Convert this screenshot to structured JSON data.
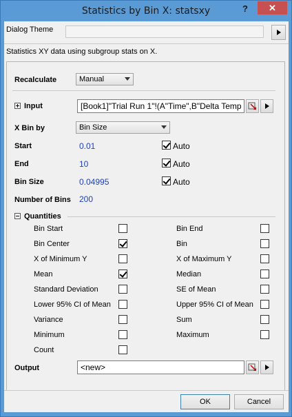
{
  "window": {
    "title": "Statistics by Bin X: statsxy",
    "help_label": "?",
    "close_label": "✕"
  },
  "theme": {
    "label": "Dialog Theme",
    "value": ""
  },
  "description": "Statistics XY data using subgroup stats on X.",
  "recalculate": {
    "label": "Recalculate",
    "value": "Manual"
  },
  "input": {
    "label": "Input",
    "value": "[Book1]\"Trial Run 1\"!(A\"Time\",B\"Delta Temp"
  },
  "xbin": {
    "label": "X Bin by",
    "value": "Bin Size"
  },
  "start": {
    "label": "Start",
    "value": "0.01",
    "auto_label": "Auto",
    "auto_checked": true
  },
  "end": {
    "label": "End",
    "value": "10",
    "auto_label": "Auto",
    "auto_checked": true
  },
  "binsize": {
    "label": "Bin Size",
    "value": "0.04995",
    "auto_label": "Auto",
    "auto_checked": true
  },
  "numbins": {
    "label": "Number of Bins",
    "value": "200"
  },
  "quantities": {
    "label": "Quantities",
    "items": [
      {
        "label": "Bin Start",
        "checked": false
      },
      {
        "label": "Bin End",
        "checked": false
      },
      {
        "label": "Bin Center",
        "checked": true
      },
      {
        "label": "Bin",
        "checked": false
      },
      {
        "label": "X of Minimum Y",
        "checked": false
      },
      {
        "label": "X of Maximum Y",
        "checked": false
      },
      {
        "label": "Mean",
        "checked": true
      },
      {
        "label": "Median",
        "checked": false
      },
      {
        "label": "Standard Deviation",
        "checked": false
      },
      {
        "label": "SE of Mean",
        "checked": false
      },
      {
        "label": "Lower 95% CI of Mean",
        "checked": false
      },
      {
        "label": "Upper 95% CI of Mean",
        "checked": false
      },
      {
        "label": "Variance",
        "checked": false
      },
      {
        "label": "Sum",
        "checked": false
      },
      {
        "label": "Minimum",
        "checked": false
      },
      {
        "label": "Maximum",
        "checked": false
      },
      {
        "label": "Count",
        "checked": false
      }
    ]
  },
  "output": {
    "label": "Output",
    "value": "<new>"
  },
  "buttons": {
    "ok": "OK",
    "cancel": "Cancel"
  }
}
